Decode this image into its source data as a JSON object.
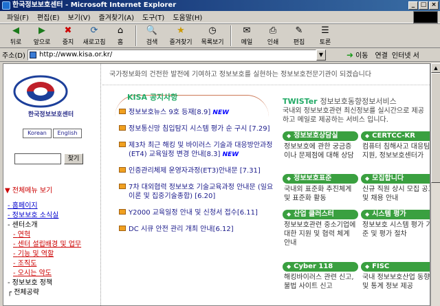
{
  "window": {
    "title": "한국정보보호센터 - Microsoft Internet Explorer"
  },
  "menubar": {
    "items": [
      "파일(F)",
      "편집(E)",
      "보기(V)",
      "즐겨찾기(A)",
      "도구(T)",
      "도움말(H)"
    ]
  },
  "toolbar": {
    "buttons": [
      {
        "label": "뒤로",
        "icon": "back-arrow-icon"
      },
      {
        "label": "앞으로",
        "icon": "forward-arrow-icon"
      },
      {
        "label": "중지",
        "icon": "stop-icon"
      },
      {
        "label": "새로고침",
        "icon": "refresh-icon"
      },
      {
        "label": "홈",
        "icon": "home-icon"
      },
      {
        "label": "검색",
        "icon": "search-icon"
      },
      {
        "label": "즐겨찾기",
        "icon": "favorites-icon"
      },
      {
        "label": "목록보기",
        "icon": "history-icon"
      },
      {
        "label": "메일",
        "icon": "mail-icon"
      },
      {
        "label": "인쇄",
        "icon": "print-icon"
      },
      {
        "label": "편집",
        "icon": "edit-icon"
      },
      {
        "label": "토론",
        "icon": "discuss-icon"
      }
    ]
  },
  "addressbar": {
    "label": "주소(D)",
    "url": "http://www.kisa.or.kr/",
    "go_label": "이동",
    "links_label": "연결",
    "links_item": "인터넷 서"
  },
  "sidebar": {
    "org_name": "한국정보보호센터",
    "lang_korean": "Korean",
    "lang_english": "English",
    "search_button": "찾기",
    "expand_all": "전체메뉴 보기",
    "tree": [
      {
        "label": "홈페이지",
        "level": 1,
        "link": true
      },
      {
        "label": "정보보호 소식실",
        "level": 1,
        "link": true
      },
      {
        "label": "센터소개",
        "level": 1,
        "link": false
      },
      {
        "label": "연혁",
        "level": 2
      },
      {
        "label": "센터 설립배경 및 업무",
        "level": 2
      },
      {
        "label": "기능 및 역할",
        "level": 2
      },
      {
        "label": "조직도",
        "level": 2
      },
      {
        "label": "오시는 약도",
        "level": 2
      },
      {
        "label": "정보보호 정책",
        "level": 1,
        "link": false
      },
      {
        "label": "전체공략",
        "level": 1,
        "link": false
      }
    ]
  },
  "main": {
    "marquee": "국가정보화의 건전한 발전에 기여하고 정보보호를 실현하는 정보보호전문기관이 되겠습니다",
    "notices_heading": "KISA 공지사항",
    "notices": [
      {
        "text": "정보보호뉴스 9호 등재[8.9]",
        "new": "NEW"
      },
      {
        "text": "정보통신망 침입탐지 시스템 평가 순 구시 [7.29]",
        "new": ""
      },
      {
        "text": "제3차 최근 해킹 및 바이러스 기술과 대응방안과정(ET4) 교육일정 변경 안내[8.3]",
        "new": "NEW"
      },
      {
        "text": "인증관리체제 운영자과정(ET3)안내문 [7.31]",
        "new": ""
      },
      {
        "text": "7차 대외협력 정보보호 기술교육과정 안내문 (일요이론 및 집중기술종합) [6.20]",
        "new": ""
      },
      {
        "text": "Y2000 교육일정 안내 및 신청서 접수[6.11]",
        "new": ""
      },
      {
        "text": "DC 시큐 안전 관리 개최 안내[6.12]",
        "new": ""
      }
    ],
    "twister_title": "TWISTer",
    "twister_sub": "정보보호동향정보서비스",
    "twister_desc": "국내외 정보보호관련 최신정보를 실시간으로 제공하고 메일로 제공하는 서비스 입니다.",
    "boxes": [
      {
        "header": "정보보호상담실",
        "body": "정보보호에 관한 궁금증이나 문제점에 대해 상담"
      },
      {
        "header": "CERTCC-KR",
        "body": "컴퓨터 침해사고 대응팀 지원, 정보보호센터가"
      },
      {
        "header": "정보보호표준",
        "body": "국내외 표준화 추진체계 및 표준화 활동"
      },
      {
        "header": "모집합니다",
        "body": "신규 직원 상시 모집 공고 및 채용 안내"
      },
      {
        "header": "산업 클러스터",
        "body": "정보보호관련 중소기업에 대한 지원 및 협력 체계 안내"
      },
      {
        "header": "시스템 평가",
        "body": "정보보호 시스템 평가 기준 및 평가 절차"
      },
      {
        "header": "Cyber 118",
        "body": "해킹바이러스 관련 신고, 불법 사이트 신고"
      },
      {
        "header": "FISC",
        "body": "국내 정보보호산업 동향 및 통계 정보 제공"
      }
    ]
  },
  "colors": {
    "title_bar": "#0a246a",
    "box_green": "#3aa040",
    "link_blue": "#0000cc",
    "heading_green": "#22aa66"
  }
}
